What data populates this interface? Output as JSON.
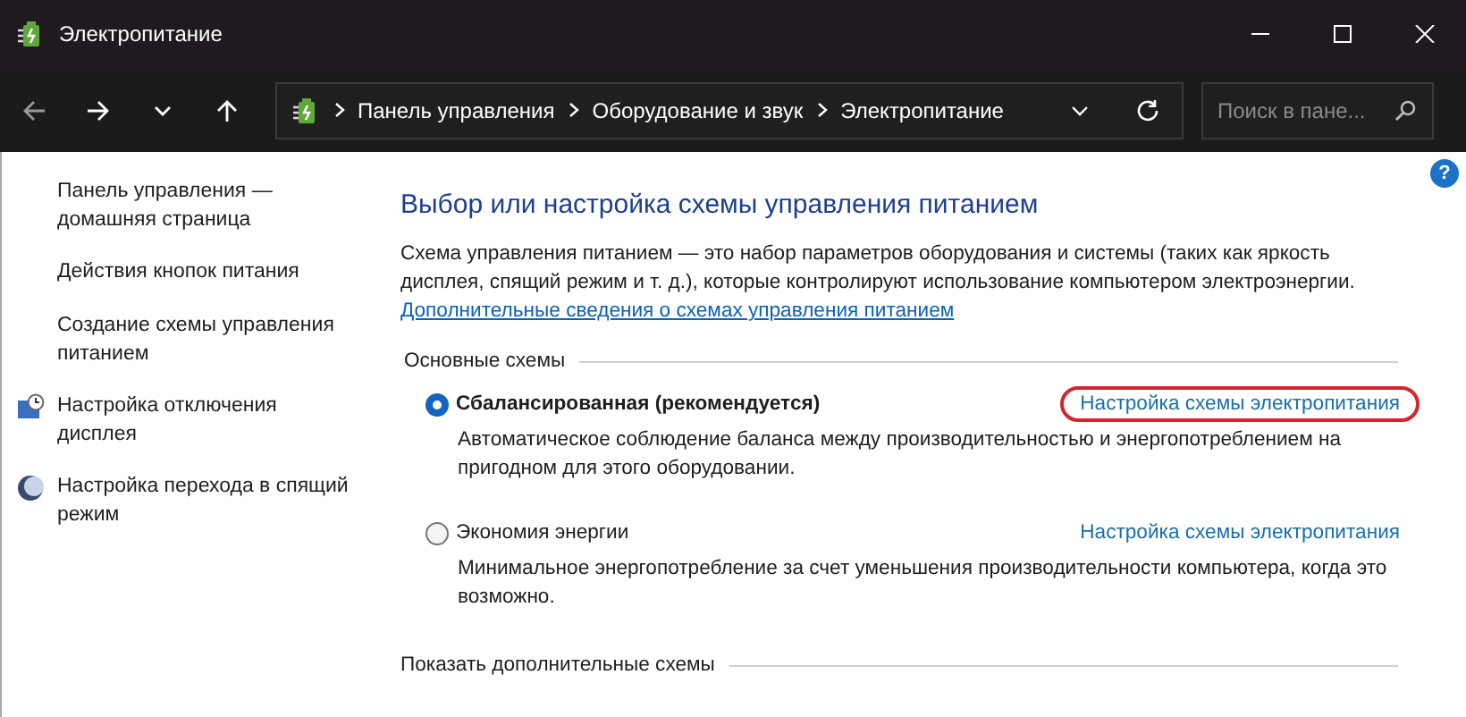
{
  "window": {
    "title": "Электропитание"
  },
  "address_bar": {
    "path": [
      "Панель управления",
      "Оборудование и звук",
      "Электропитание"
    ],
    "search_placeholder": "Поиск в пане..."
  },
  "sidebar": {
    "items": [
      {
        "label": "Панель управления — домашняя страница",
        "kind": "plain"
      },
      {
        "label": "Действия кнопок питания",
        "kind": "plain"
      },
      {
        "label": "Создание схемы управления питанием",
        "kind": "plain"
      },
      {
        "label": "Настройка отключения дисплея",
        "kind": "display"
      },
      {
        "label": "Настройка перехода в спящий режим",
        "kind": "sleep"
      }
    ]
  },
  "main": {
    "help": "?",
    "heading": "Выбор или настройка схемы управления питанием",
    "description": "Схема управления питанием — это набор параметров оборудования и системы (таких как яркость дисплея, спящий режим и т. д.), которые контролируют использование компьютером электроэнергии.",
    "more_link": "Дополнительные сведения о схемах управления питанием",
    "section_title": "Основные схемы",
    "plans": [
      {
        "name": "Сбалансированная (рекомендуется)",
        "selected": true,
        "link": "Настройка схемы электропитания",
        "highlighted": true,
        "description": "Автоматическое соблюдение баланса между производительностью и энергопотреблением на пригодном для этого оборудовании."
      },
      {
        "name": "Экономия энергии",
        "selected": false,
        "link": "Настройка схемы электропитания",
        "highlighted": false,
        "description": "Минимальное энергопотребление за счет уменьшения производительности компьютера, когда это возможно."
      }
    ],
    "more_plans": "Показать дополнительные схемы"
  }
}
